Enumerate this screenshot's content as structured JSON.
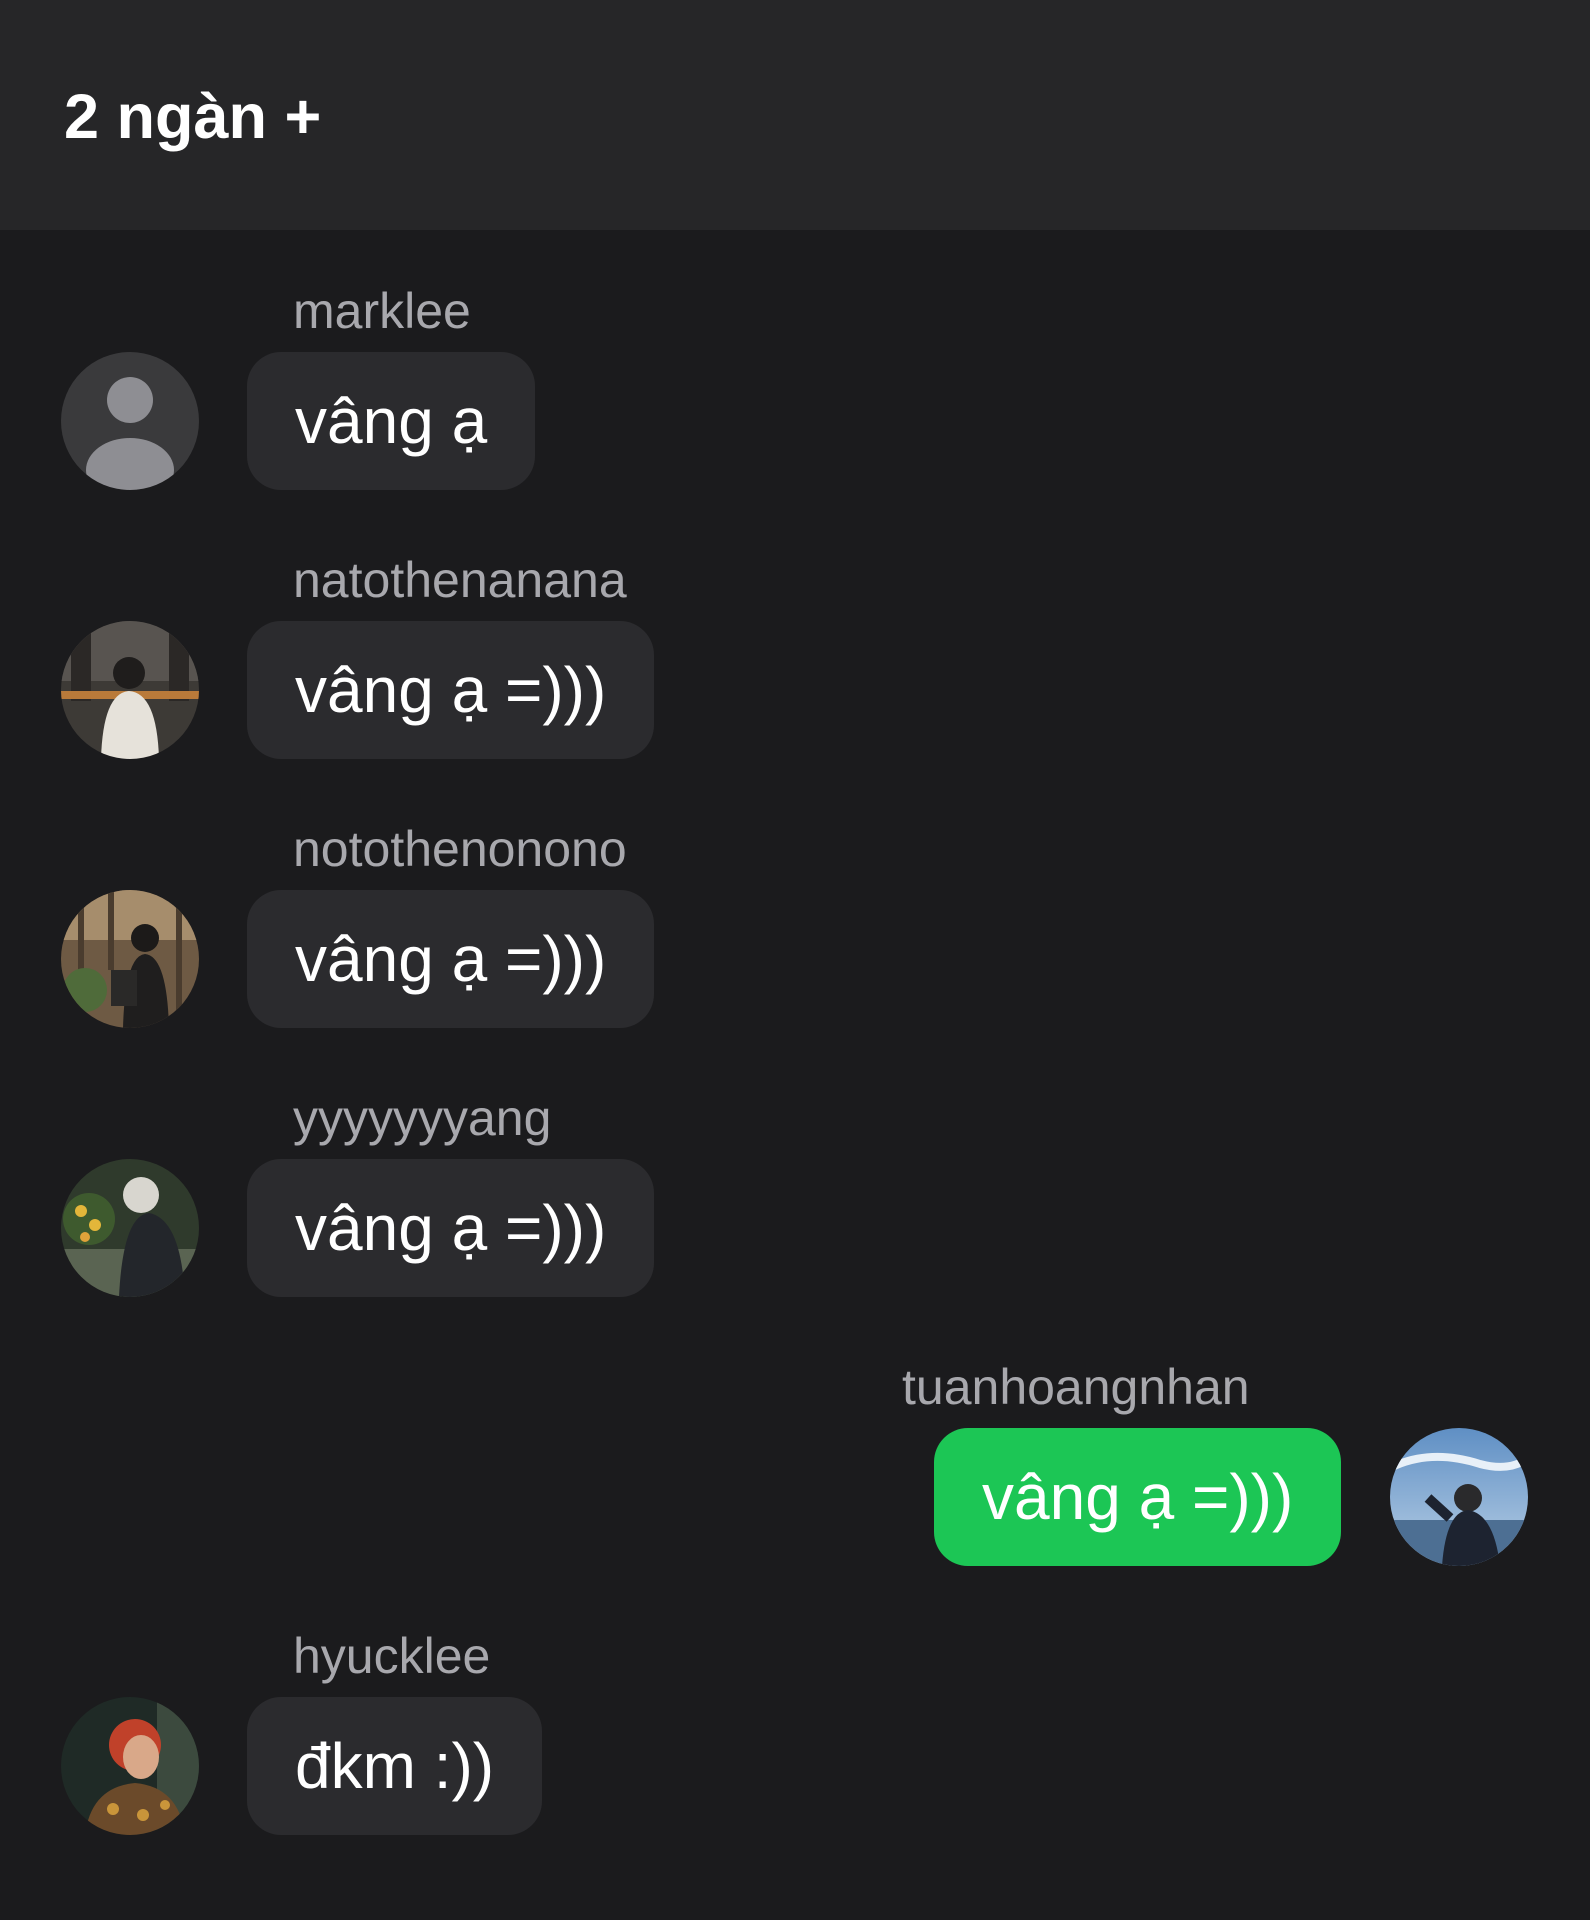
{
  "header": {
    "title": "2 ngàn +"
  },
  "messages": [
    {
      "sender": "marklee",
      "text": "vâng ạ",
      "avatar_icon": "default-person-avatar"
    },
    {
      "sender": "natothenanana",
      "text": "vâng ạ =)))",
      "avatar_icon": "photo-avatar"
    },
    {
      "sender": "notothenonono",
      "text": "vâng ạ =)))",
      "avatar_icon": "photo-avatar"
    },
    {
      "sender": "yyyyyyyang",
      "text": "vâng ạ =)))",
      "avatar_icon": "photo-avatar"
    },
    {
      "sender": "tuanhoangnhan",
      "text": "vâng ạ =)))",
      "avatar_icon": "photo-avatar",
      "mine": true
    },
    {
      "sender": "hyucklee",
      "text": "đkm :))",
      "avatar_icon": "photo-avatar"
    }
  ],
  "colors": {
    "background": "#1b1b1d",
    "header": "#262628",
    "bubble": "#2b2b2e",
    "my_bubble": "#1cc655",
    "sender_text": "#a8a8ad"
  }
}
